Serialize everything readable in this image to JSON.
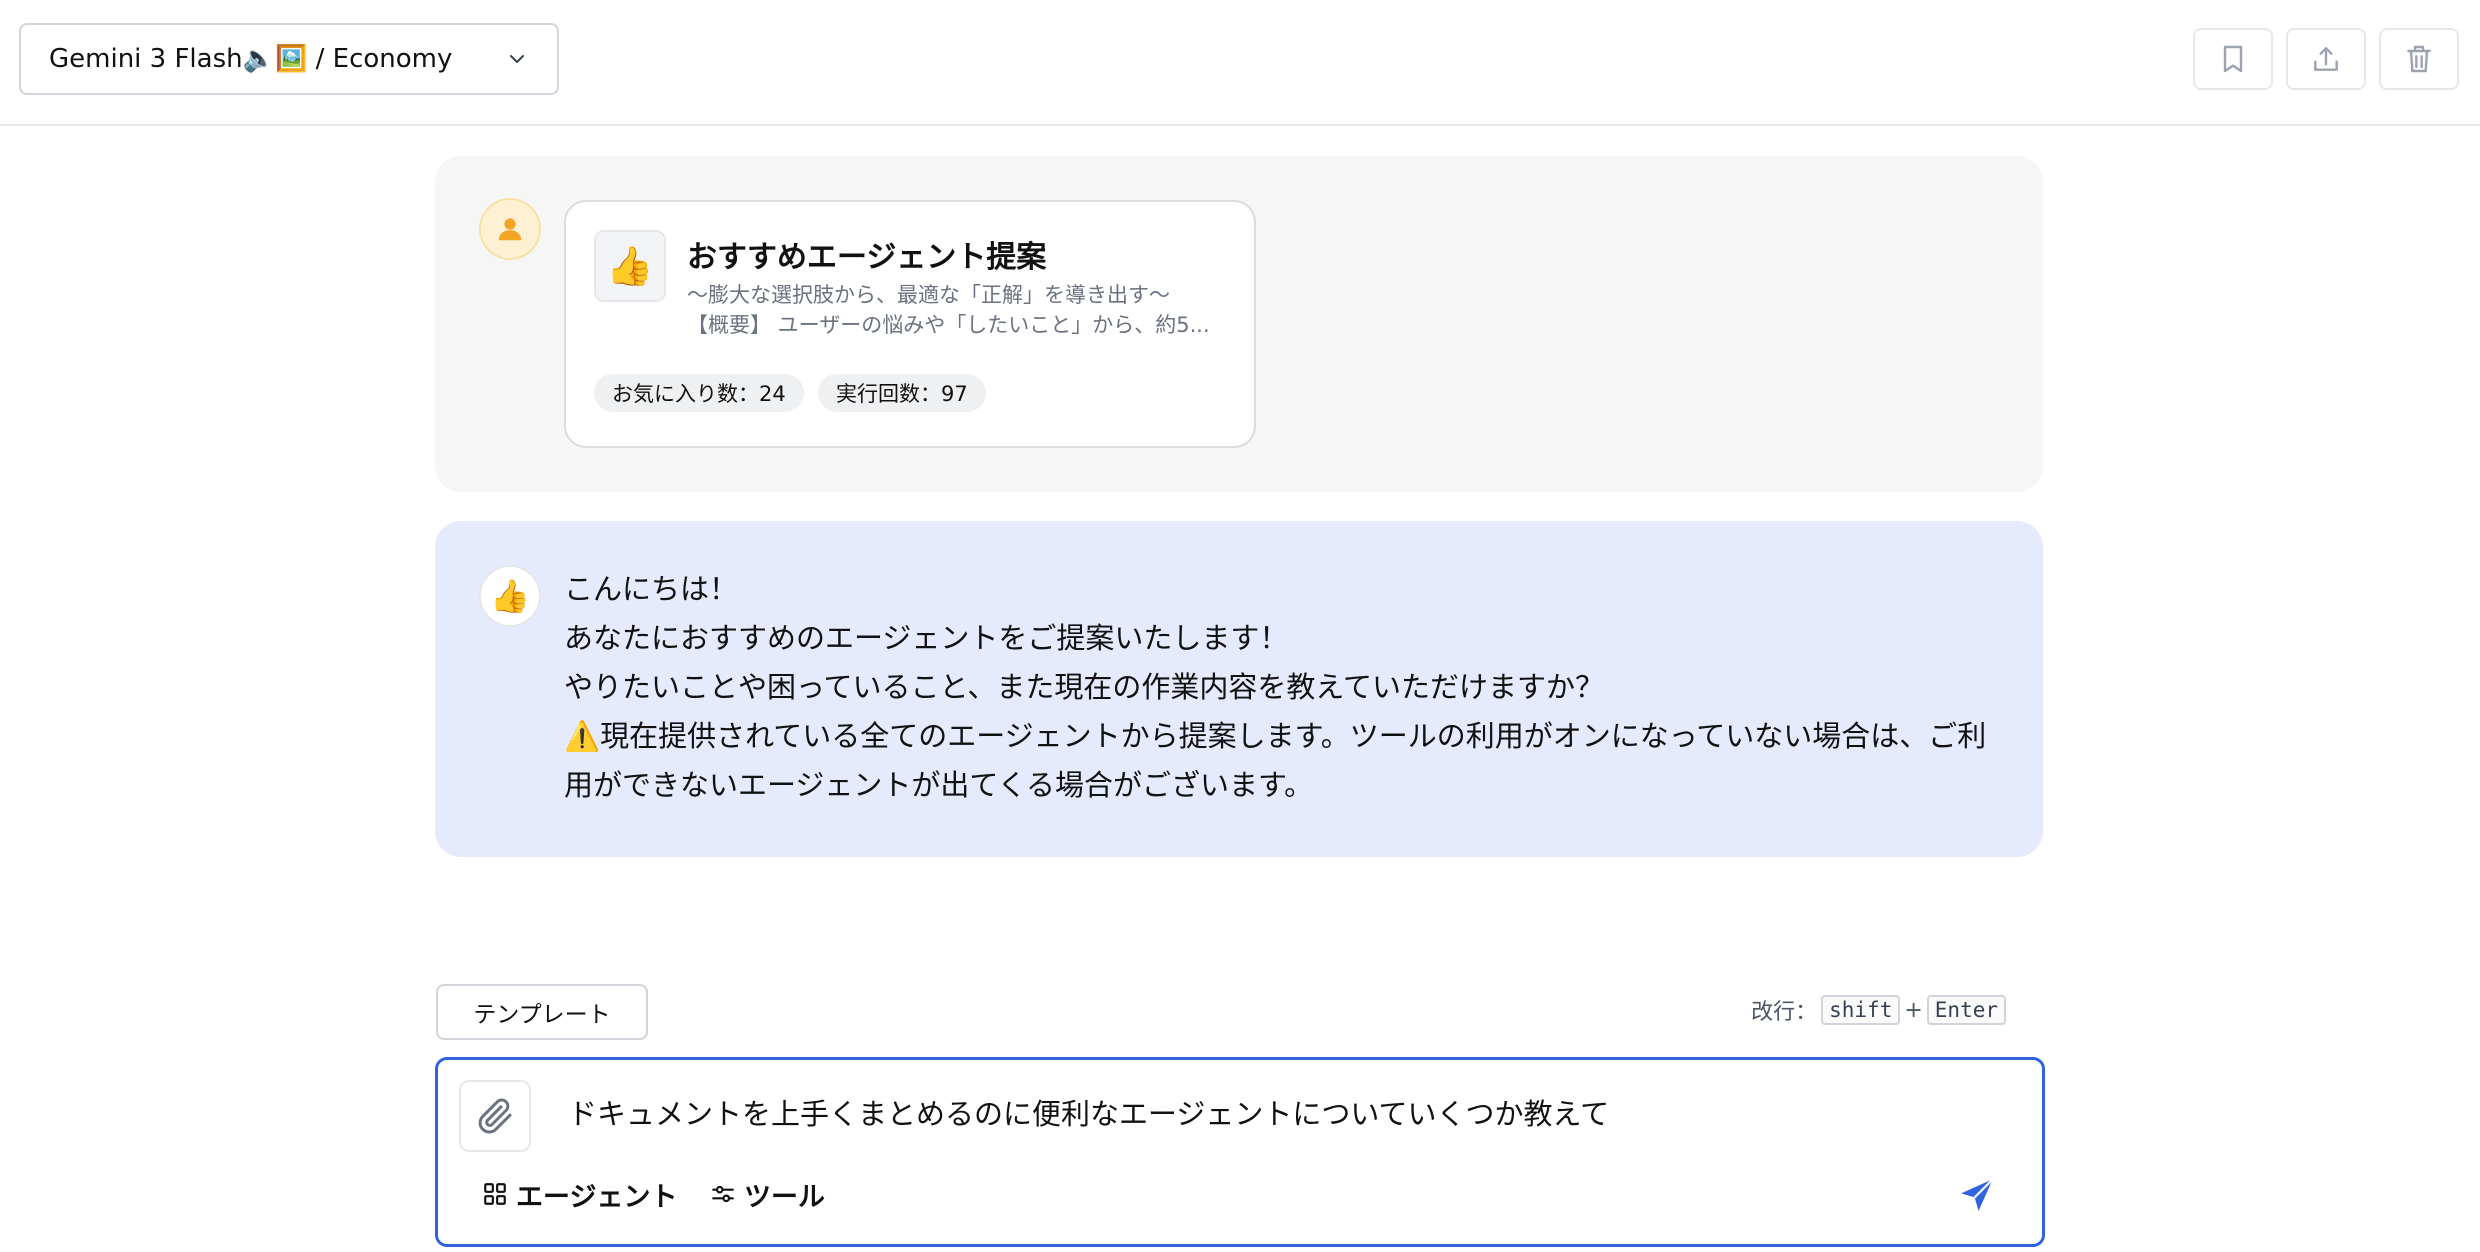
{
  "header": {
    "model_label": "Gemini 3 Flash🔈🖼️ / Economy",
    "icons": [
      "chevron-down-icon",
      "bookmark-icon",
      "share-icon",
      "trash-icon"
    ]
  },
  "messages": [
    {
      "role": "user",
      "avatar_icon": "user-icon",
      "agent_card": {
        "icon": "👍",
        "title": "おすすめエージェント提案",
        "description_line1": "〜膨大な選択肢から、最適な「正解」を導き出す〜",
        "description_line2": "【概要】 ユーザーの悩みや「したいこと」から、約5...",
        "favorites": "お気に入り数：24",
        "runs": "実行回数：97"
      }
    },
    {
      "role": "assistant",
      "avatar_icon": "👍",
      "lines": [
        "こんにちは！",
        "あなたにおすすめのエージェントをご提案いたします！",
        "やりたいことや困っていること、また現在の作業内容を教えていただけますか？",
        "⚠️現在提供されている全てのエージェントから提案します。ツールの利用がオンになっていない場合は、ご利用ができないエージェントが出てくる場合がございます。"
      ]
    }
  ],
  "composer": {
    "template_label": "テンプレート",
    "newline_label": "改行：",
    "key_shift": "shift",
    "plus": "+",
    "key_enter": "Enter",
    "input_value": "ドキュメントを上手くまとめるのに便利なエージェントについていくつか教えて",
    "agent_label": "エージェント",
    "tool_label": "ツール",
    "send_icon": "send-icon",
    "attach_icon": "paperclip-icon"
  },
  "colors": {
    "accent": "#2f63e0",
    "assistant_bg": "#e5eafc",
    "user_bg": "#f6f6f6"
  }
}
